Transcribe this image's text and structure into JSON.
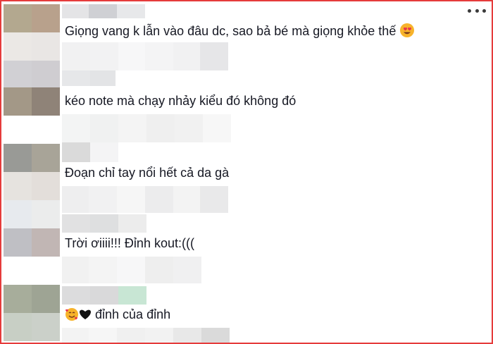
{
  "toolbar": {
    "more_icon": "more-horizontal-icon"
  },
  "comments": [
    {
      "text": "Giọng vang k lẫn vào đâu dc, sao bả bé mà giọng khỏe thế",
      "trailing_icon": "smiling-face-with-heart-eyes-icon"
    },
    {
      "text": "kéo note mà chạy nhảy kiểu đó không đó"
    },
    {
      "text": "Đoạn chỉ tay nổi hết cả da gà"
    },
    {
      "text": "Trời ơiiii!!! Đỉnh kout:((("
    },
    {
      "text": "đỉnh của đỉnh",
      "leading_icons": [
        "smiling-face-with-hearts-icon",
        "black-heart-icon"
      ]
    }
  ],
  "colors": {
    "frame_border": "#e53b3b",
    "text": "#161823"
  }
}
